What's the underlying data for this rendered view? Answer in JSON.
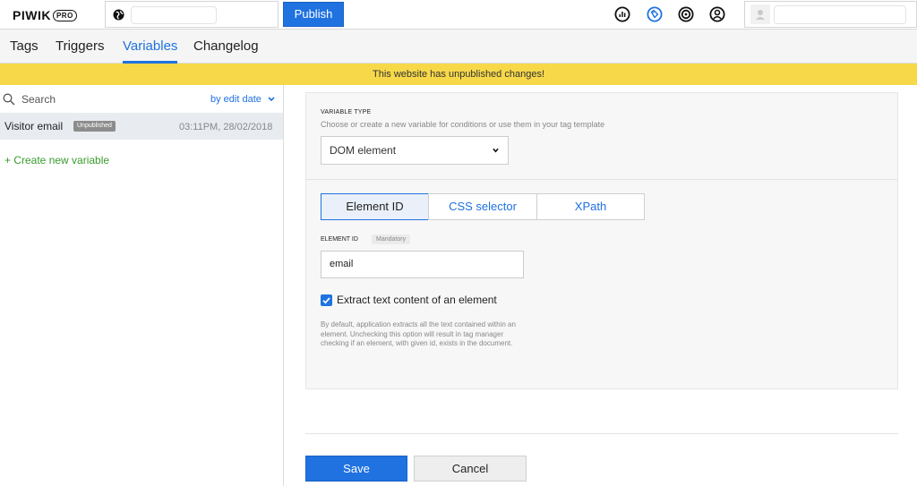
{
  "header": {
    "logo_text": "PIWIK",
    "logo_badge": "PRO",
    "publish_label": "Publish",
    "site_icon": "globe-icon",
    "right_icons": [
      "analytics-icon",
      "tag-manager-icon",
      "target-icon",
      "user-profile-icon"
    ],
    "accent_color": "#1f72e0"
  },
  "tabs": [
    {
      "label": "Tags",
      "active": false
    },
    {
      "label": "Triggers",
      "active": false
    },
    {
      "label": "Variables",
      "active": true
    },
    {
      "label": "Changelog",
      "active": false
    }
  ],
  "banner": {
    "text": "This website has unpublished changes!",
    "color": "#f7d849"
  },
  "sidebar": {
    "search_placeholder": "Search",
    "sort_label": "by edit date",
    "items": [
      {
        "name": "Visitor email",
        "badge": "Unpublished",
        "date": "03:11PM, 28/02/2018"
      }
    ],
    "create_label": "+ Create new variable"
  },
  "form": {
    "variable_type_title": "VARIABLE TYPE",
    "variable_type_desc": "Choose or create a new variable for conditions or use them in your tag template",
    "variable_type_value": "DOM element",
    "segments": [
      {
        "label": "Element ID",
        "active": true
      },
      {
        "label": "CSS selector",
        "active": false
      },
      {
        "label": "XPath",
        "active": false
      }
    ],
    "element_id_label": "ELEMENT ID",
    "element_id_badge": "Mandatory",
    "element_id_value": "email",
    "extract_label": "Extract text content of an element",
    "extract_checked": true,
    "help_text": "By default, application extracts all the text contained within an element. Unchecking this option will result in tag manager checking if an element, with given id, exists in the document."
  },
  "footer": {
    "save_label": "Save",
    "cancel_label": "Cancel"
  }
}
